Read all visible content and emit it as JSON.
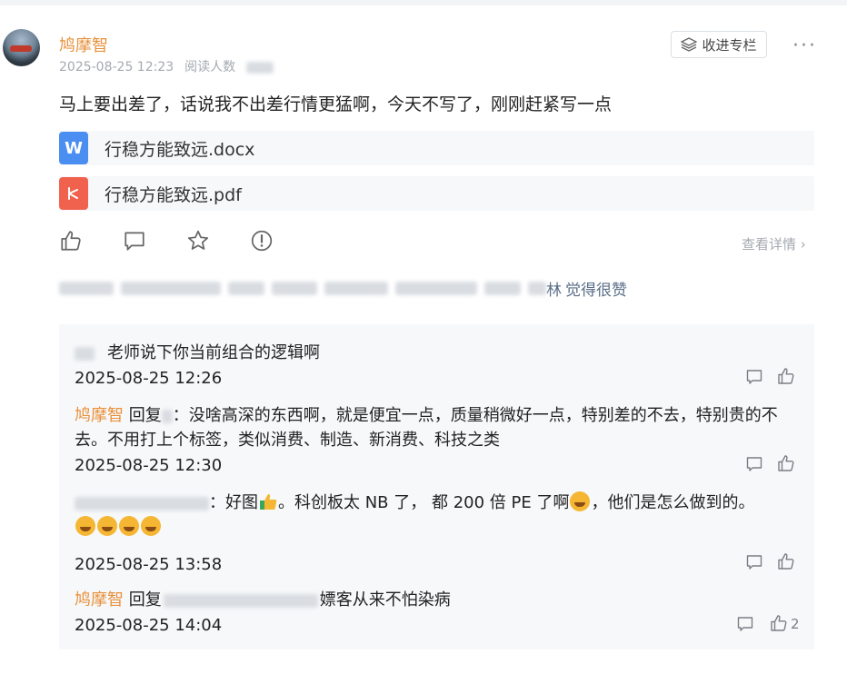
{
  "post": {
    "author": "鸠摩智",
    "date": "2025-08-25 12:23",
    "read_label": "阅读人数",
    "collect_label": "收进专栏",
    "text": "马上要出差了，话说我不出差行情更猛啊，今天不写了，刚刚赶紧写一点",
    "files": [
      {
        "name": "行稳方能致远.docx",
        "icon": "word-doc-icon",
        "color": "#4b8ef1"
      },
      {
        "name": "行稳方能致远.pdf",
        "icon": "pdf-icon",
        "color": "#f0624d"
      }
    ],
    "detail_label": "查看详情",
    "likers_suffix": "觉得很赞",
    "likers_last": "林"
  },
  "comments": [
    {
      "text": "老师说下你当前组合的逻辑啊",
      "time": "2025-08-25 12:26"
    },
    {
      "name": "鸠摩智",
      "reply_word": "回复",
      "text": "：没啥高深的东西啊，就是便宜一点，质量稍微好一点，特别差的不去，特别贵的不去。不用打上个标签，类似消费、制造、新消费、科技之类",
      "time": "2025-08-25 12:30"
    },
    {
      "text_a": "：好图",
      "text_b": "。科创板太 NB 了， 都 200 倍 PE 了啊",
      "text_c": "，他们是怎么做到的。",
      "time": "2025-08-25 13:58"
    },
    {
      "name": "鸠摩智",
      "reply_word": "回复",
      "text": "嫖客从来不怕染病",
      "time": "2025-08-25 14:04",
      "likes": "2"
    }
  ],
  "colors": {
    "accent_name": "#e8913b",
    "link_blue": "#5b6f88",
    "muted": "#a5a9b0"
  }
}
